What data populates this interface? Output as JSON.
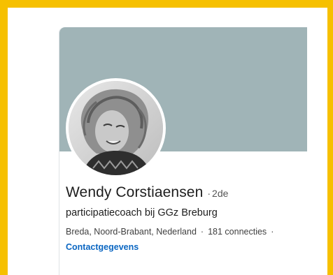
{
  "profile": {
    "name": "Wendy Corstiaensen",
    "separator": "·",
    "degree": "2de",
    "headline": "participatiecoach bij GGz Breburg",
    "location": "Breda, Noord-Brabant, Nederland",
    "connections": "181 connecties",
    "trailing_separator": "·",
    "contact_link": "Contactgegevens"
  },
  "colors": {
    "frame_border": "#f6c000",
    "banner": "#a0b4b7",
    "link": "#0a66c2"
  },
  "icons": {
    "avatar": "profile-photo"
  }
}
